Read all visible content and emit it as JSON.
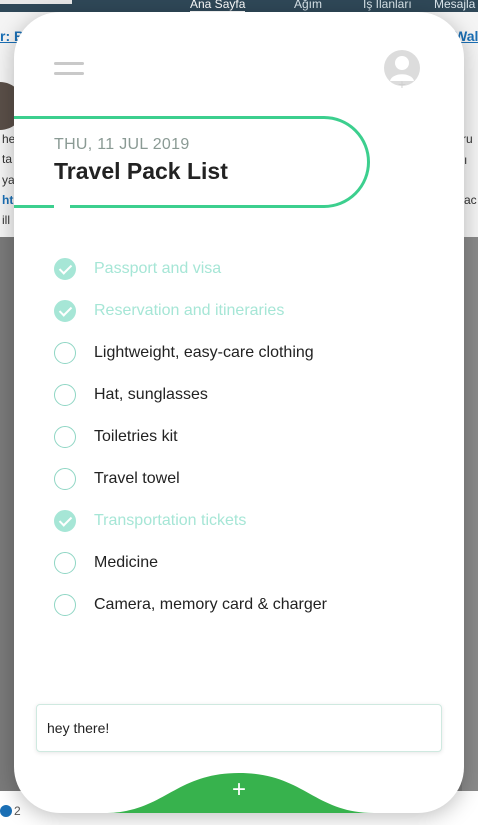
{
  "background": {
    "tabs": [
      "Ana Sayfa",
      "Ağım",
      "İş İlanları",
      "Mesajla"
    ],
    "link_left": "r: B",
    "link_right": "Wal",
    "fragments": [
      "he",
      "ta",
      "ya",
      "ht",
      "ill",
      "ru",
      "ı",
      "ac"
    ],
    "reaction_count": "2"
  },
  "colors": {
    "accent": "#3ccf8e",
    "check_done": "#a6e6d6",
    "text": "#222222"
  },
  "header": {
    "date": "THU, 11 JUL 2019",
    "title": "Travel Pack List"
  },
  "icons": {
    "menu": "hamburger-icon",
    "user": "user-avatar-icon",
    "add": "plus-icon"
  },
  "tasks": [
    {
      "label": "Passport and visa",
      "done": true
    },
    {
      "label": "Reservation and itineraries",
      "done": true
    },
    {
      "label": "Lightweight, easy-care clothing",
      "done": false
    },
    {
      "label": "Hat, sunglasses",
      "done": false
    },
    {
      "label": "Toiletries kit",
      "done": false
    },
    {
      "label": "Travel towel",
      "done": false
    },
    {
      "label": "Transportation tickets",
      "done": true
    },
    {
      "label": "Medicine",
      "done": false
    },
    {
      "label": "Camera, memory card & charger",
      "done": false
    }
  ],
  "input": {
    "value": "hey there!"
  },
  "add_button": {
    "label": "+"
  }
}
